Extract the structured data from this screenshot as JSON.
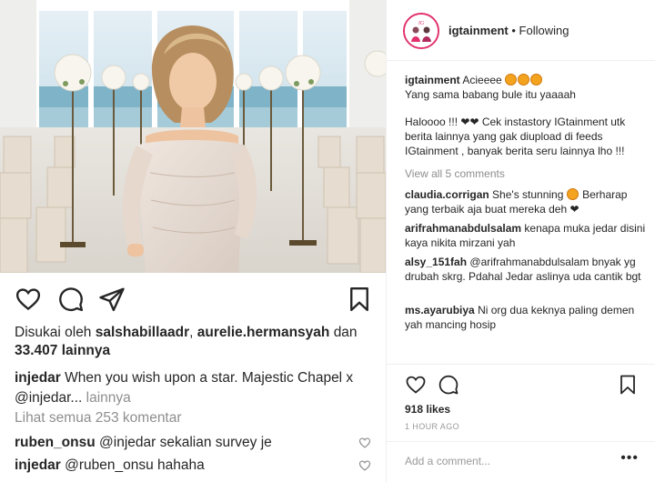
{
  "post": {
    "username": "injedar",
    "liked_by_label": "Disukai oleh",
    "liked_by_user1": "salshabillaadr",
    "liked_by_sep": ",",
    "liked_by_user2": "aurelie.hermansyah",
    "liked_by_and": "dan",
    "likes_count": "33.407 lainnya",
    "caption": "When you wish upon a star. Majestic Chapel x",
    "caption_tag": "@injedar...",
    "caption_more": "lainnya",
    "view_all_comments": "Lihat semua 253 komentar",
    "comments": [
      {
        "user": "ruben_onsu",
        "text": "@injedar sekalian survey je"
      },
      {
        "user": "injedar",
        "text": "@ruben_onsu hahaha"
      }
    ]
  },
  "repost": {
    "account": "igtainment",
    "separator": "•",
    "follow_state": "Following",
    "caption_user": "igtainment",
    "caption_line1": "Acieeee",
    "caption_line2": "Yang sama babang bule itu yaaaah",
    "caption_line3": "Haloooo !!!",
    "caption_line3b": "Cek instastory IGtainment utk berita lainnya yang gak diupload di feeds IGtainment , banyak berita seru lainnya lho !!!",
    "view_all": "View all 5 comments",
    "comments": [
      {
        "user": "claudia.corrigan",
        "text": "She's stunning",
        "text2": "Berharap yang terbaik aja buat mereka deh"
      },
      {
        "user": "arifrahmanabdulsalam",
        "text": "kenapa muka jedar disini kaya nikita mirzani yah"
      },
      {
        "user": "alsy_151fah",
        "text": "@arifrahmanabdulsalam bnyak yg drubah skrg. Pdahal Jedar aslinya uda cantik bgt"
      },
      {
        "user": "ms.ayarubiya",
        "text": "Ni org dua keknya paling demen yah mancing hosip"
      }
    ],
    "likes": "918 likes",
    "time": "1 HOUR AGO",
    "add_comment_placeholder": "Add a comment...",
    "more": "•••"
  },
  "icons": {
    "like": "heart-icon",
    "comment": "comment-icon",
    "share": "share-icon",
    "save": "bookmark-icon"
  },
  "colors": {
    "text": "#262626",
    "muted": "#8e8e8e",
    "divider": "#efefef",
    "emoji": "#f4a31f"
  }
}
